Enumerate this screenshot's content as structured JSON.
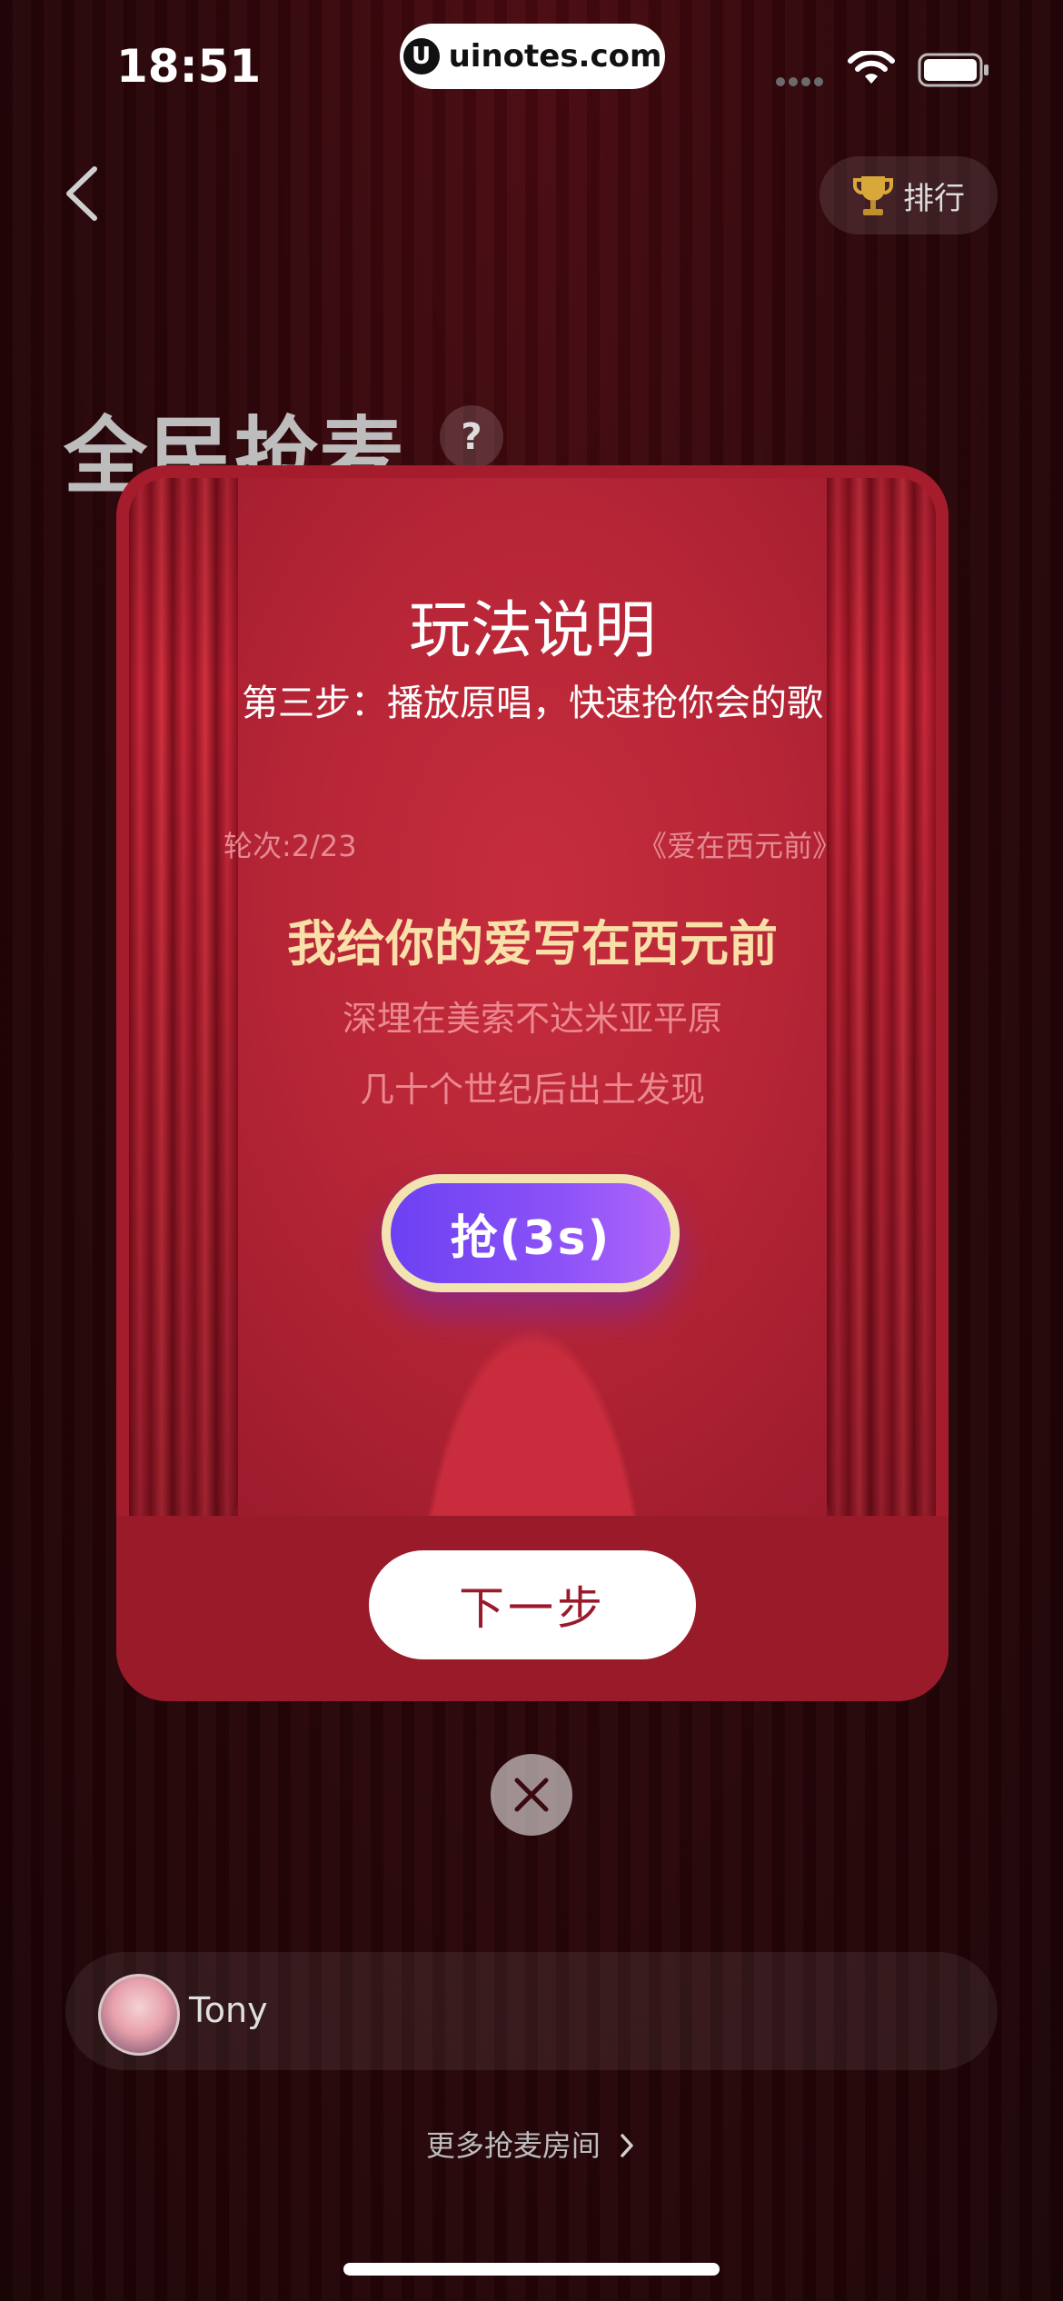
{
  "status_bar": {
    "time": "18:51",
    "url": "uinotes.com",
    "url_icon_glyph": "U"
  },
  "header": {
    "back_icon": "chevron-left-icon",
    "rank_label": "排行",
    "rank_icon": "trophy-icon",
    "page_title": "全民抢麦",
    "help_label": "?"
  },
  "modal": {
    "title": "玩法说明",
    "subtitle": "第三步：播放原唱，快速抢你会的歌",
    "round_label": "轮次:2/23",
    "song_title": "《爱在西元前》",
    "lyrics": {
      "main": "我给你的爱写在西元前",
      "line2": "深埋在美索不达米亚平原",
      "line3": "几十个世纪后出土发现"
    },
    "grab_label": "抢(3s)",
    "grab_countdown_progress": 0.8,
    "next_label": "下一步"
  },
  "user": {
    "name": "Tony"
  },
  "footer": {
    "more_rooms": "更多抢麦房间"
  },
  "colors": {
    "background": "#2c060a",
    "modal": "#a51d2d",
    "lyric_main": "#f9dfa8",
    "lyric_sub": "#ec8891",
    "grab_button": "#8c52f7",
    "next_text": "#9a1a2b"
  }
}
